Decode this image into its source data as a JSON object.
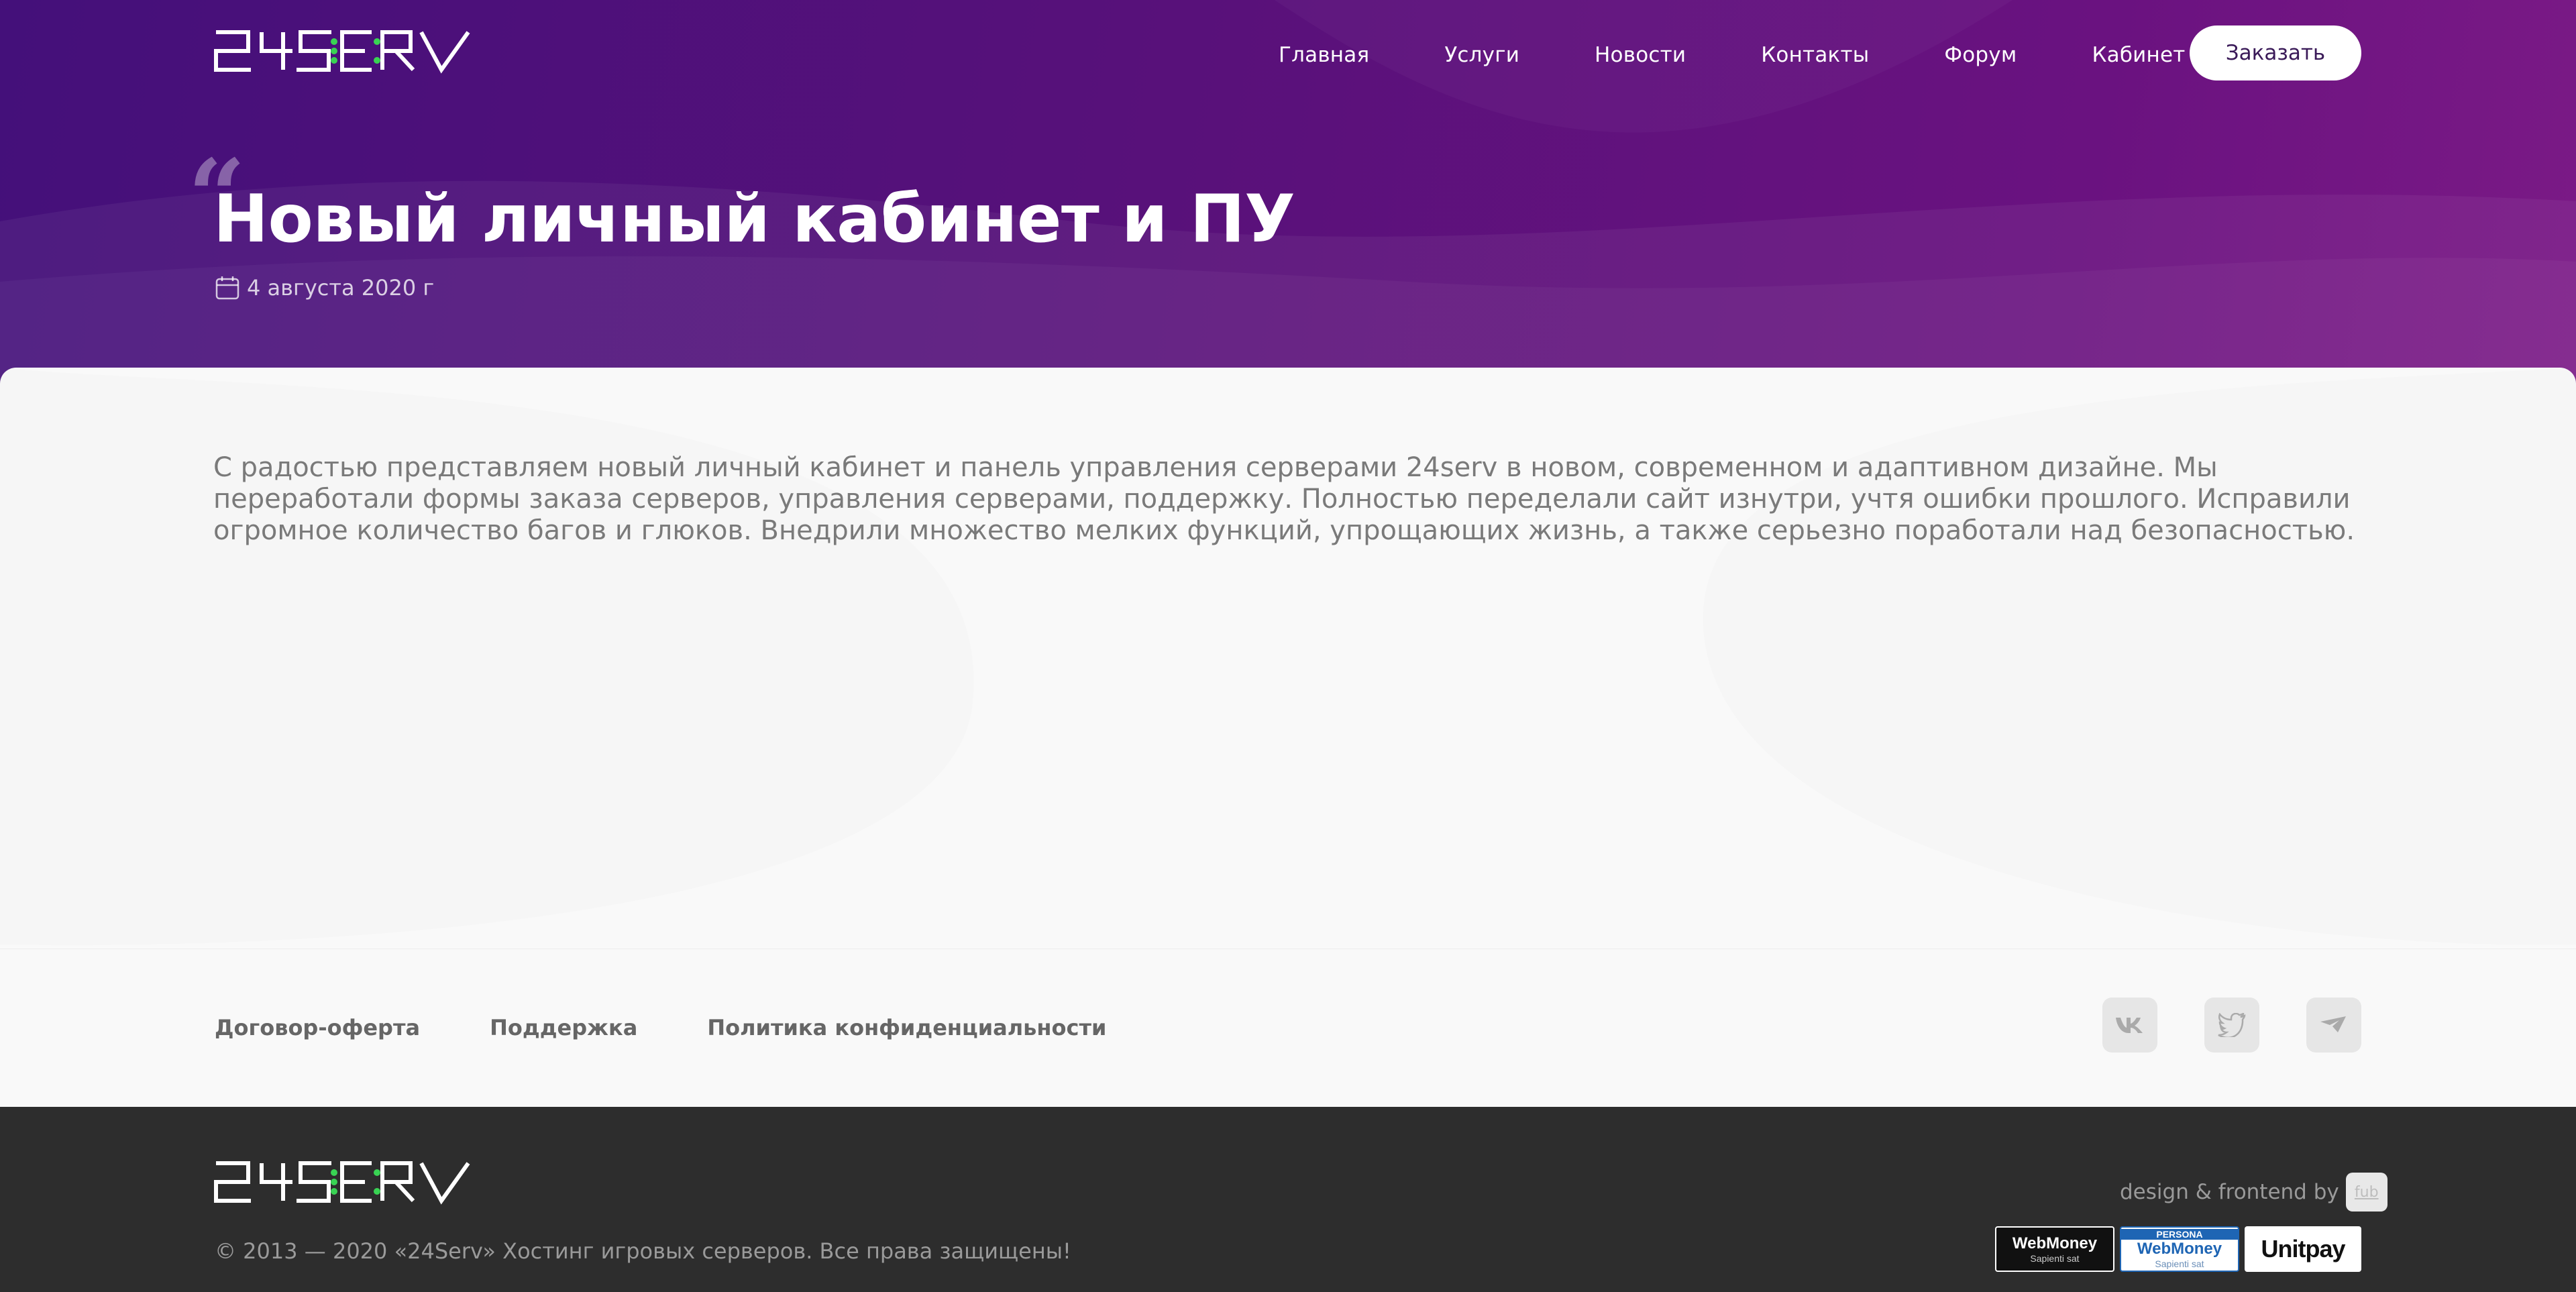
{
  "brand": {
    "logo_text": "24SERV",
    "accent_color": "#6a1280",
    "logo_dot_color": "#39d353"
  },
  "nav": {
    "items": [
      "Главная",
      "Услуги",
      "Новости",
      "Контакты",
      "Форум",
      "Кабинет"
    ],
    "order_button": "Заказать"
  },
  "article": {
    "title": "Новый личный кабинет и ПУ",
    "date": "4 августа 2020 г",
    "body": "С радостью представляем новый личный кабинет и панель управления серверами 24serv в новом, современном и адаптивном дизайне. Мы переработали формы заказа серверов, управления серверами, поддержку. Полностью переделали сайт изнутри, учтя ошибки прошлого. Исправили огромное количество багов и глюков. Внедрили множество мелких функций, упрощающих жизнь, а также серьезно поработали над безопасностью."
  },
  "footer": {
    "links": [
      "Договор-оферта",
      "Поддержка",
      "Политика конфиденциальности"
    ],
    "social_icons": [
      "vk-icon",
      "twitter-icon",
      "telegram-icon"
    ],
    "copyright": "© 2013 — 2020 «24Serv» Хостинг игровых серверов. Все права защищены!",
    "credit": "design & frontend by",
    "credit_badge": "fub",
    "payments": {
      "webmoney": {
        "name": "WebMoney",
        "tagline": "Sapienti sat"
      },
      "webmoney_persona": {
        "label": "PERSONA",
        "name": "WebMoney",
        "tagline": "Sapienti sat"
      },
      "unitpay": {
        "name": "Unitpay"
      }
    }
  }
}
